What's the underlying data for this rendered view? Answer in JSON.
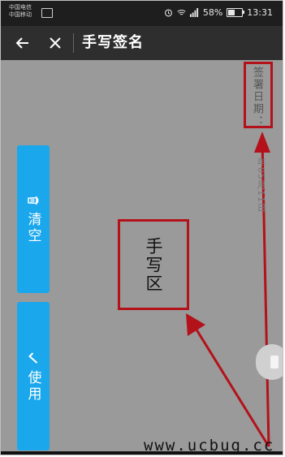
{
  "status_bar": {
    "carrier_1": "中国电信",
    "carrier_2": "中国移动",
    "battery_percent": "58%",
    "battery_level": 0.58,
    "time": "13:31",
    "icons": [
      "alarm-icon",
      "wifi-icon",
      "signal-icon",
      "battery-icon"
    ]
  },
  "app_bar": {
    "back_icon": "back-arrow-icon",
    "close_icon": "close-icon",
    "title": "手写签名"
  },
  "canvas": {
    "clear_button_label": "清空",
    "clear_icon": "trash-icon",
    "use_button_label": "使用",
    "use_icon": "check-icon",
    "sign_date_label": "签署日期：",
    "sign_date_value": "年05月11日",
    "annotation_label": "手写区",
    "button_color": "#1aa7ec",
    "annotation_color": "#b3121a"
  },
  "watermark": "www.ucbug.cc"
}
